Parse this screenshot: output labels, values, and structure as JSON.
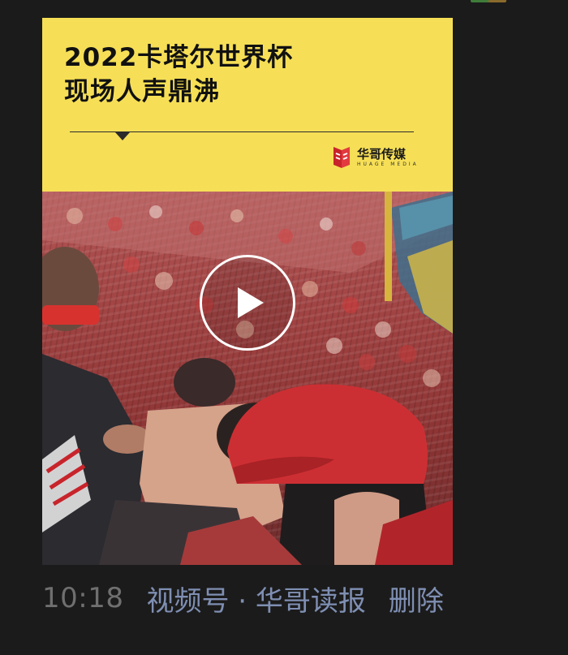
{
  "post": {
    "card": {
      "title_line1": "2022卡塔尔世界杯",
      "title_line2": "现场人声鼎沸",
      "brand_name": "华哥传媒",
      "brand_subtitle": "HUAGE MEDIA",
      "brand_color": "#c8242b",
      "header_color": "#f6df56"
    },
    "video": {
      "play_icon": "play-icon"
    },
    "meta": {
      "time": "10:18",
      "channel": "视频号 · 华哥读报",
      "delete_label": "删除",
      "link_color": "#7f8fb3",
      "time_color": "#6f6f6f"
    }
  }
}
